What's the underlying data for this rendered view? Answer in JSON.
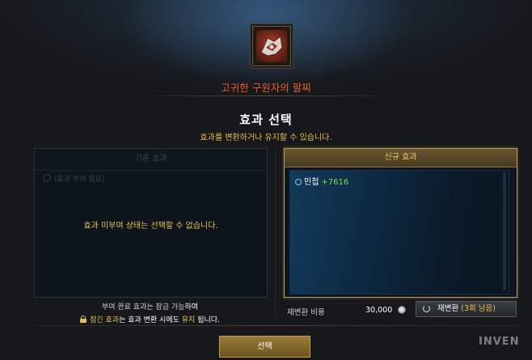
{
  "item": {
    "name": "고귀한 구원자의 팔찌",
    "icon": "bracelet-icon"
  },
  "section": {
    "title": "효과 선택",
    "subtitle": "효과를 변환하거나 유지할 수 있습니다."
  },
  "current_panel": {
    "header": "기존 효과",
    "placeholder": "(효과 부여 필요)",
    "message": "효과 미부여 상태는 선택할 수 없습니다."
  },
  "new_panel": {
    "header": "신규 효과",
    "effects": [
      {
        "name": "민첩",
        "value": "+7616",
        "icon": "stat-icon"
      }
    ]
  },
  "footer": {
    "line1_a": "부여 완료 효과는 잠금 가능",
    "line1_b": "하며",
    "line2_a": "잠긴 효과",
    "line2_b": "는 효과 변환 시에도 ",
    "line2_c": "유지",
    "line2_d": " 됩니다."
  },
  "cost": {
    "label": "재변환 비용",
    "value": "30,000",
    "currency_icon": "silver-coin-icon"
  },
  "reroll_button": {
    "label": "재변환 ",
    "remaining": "(3회 남음)"
  },
  "select_button": {
    "label": "선택"
  },
  "watermark": "INVEN",
  "colors": {
    "accent_gold": "#e8c14a",
    "item_name": "#e9612d",
    "stat_value": "#7ee04a",
    "button_gold": "#9a7a35"
  }
}
